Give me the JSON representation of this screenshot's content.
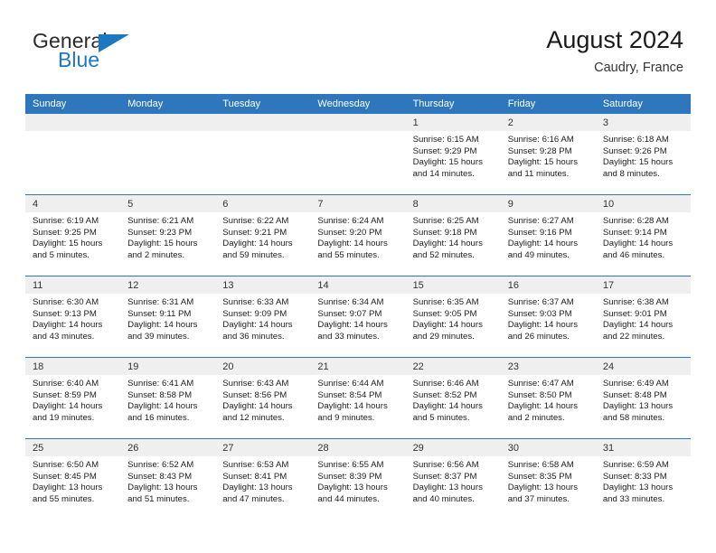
{
  "brand": {
    "name_part1": "General",
    "name_part2": "Blue",
    "accent_color": "#1c78c0"
  },
  "header": {
    "title": "August 2024",
    "subtitle": "Caudry, France"
  },
  "calendar": {
    "header_color": "#2e77bc",
    "daynum_band_color": "#efefef",
    "weekday_labels": [
      "Sunday",
      "Monday",
      "Tuesday",
      "Wednesday",
      "Thursday",
      "Friday",
      "Saturday"
    ],
    "labels": {
      "sunrise": "Sunrise:",
      "sunset": "Sunset:",
      "daylight": "Daylight:"
    },
    "weeks": [
      [
        {
          "day": "",
          "empty": true
        },
        {
          "day": "",
          "empty": true
        },
        {
          "day": "",
          "empty": true
        },
        {
          "day": "",
          "empty": true
        },
        {
          "day": "1",
          "sunrise": "Sunrise: 6:15 AM",
          "sunset": "Sunset: 9:29 PM",
          "daylight_line1": "Daylight: 15 hours",
          "daylight_line2": "and 14 minutes."
        },
        {
          "day": "2",
          "sunrise": "Sunrise: 6:16 AM",
          "sunset": "Sunset: 9:28 PM",
          "daylight_line1": "Daylight: 15 hours",
          "daylight_line2": "and 11 minutes."
        },
        {
          "day": "3",
          "sunrise": "Sunrise: 6:18 AM",
          "sunset": "Sunset: 9:26 PM",
          "daylight_line1": "Daylight: 15 hours",
          "daylight_line2": "and 8 minutes."
        }
      ],
      [
        {
          "day": "4",
          "sunrise": "Sunrise: 6:19 AM",
          "sunset": "Sunset: 9:25 PM",
          "daylight_line1": "Daylight: 15 hours",
          "daylight_line2": "and 5 minutes."
        },
        {
          "day": "5",
          "sunrise": "Sunrise: 6:21 AM",
          "sunset": "Sunset: 9:23 PM",
          "daylight_line1": "Daylight: 15 hours",
          "daylight_line2": "and 2 minutes."
        },
        {
          "day": "6",
          "sunrise": "Sunrise: 6:22 AM",
          "sunset": "Sunset: 9:21 PM",
          "daylight_line1": "Daylight: 14 hours",
          "daylight_line2": "and 59 minutes."
        },
        {
          "day": "7",
          "sunrise": "Sunrise: 6:24 AM",
          "sunset": "Sunset: 9:20 PM",
          "daylight_line1": "Daylight: 14 hours",
          "daylight_line2": "and 55 minutes."
        },
        {
          "day": "8",
          "sunrise": "Sunrise: 6:25 AM",
          "sunset": "Sunset: 9:18 PM",
          "daylight_line1": "Daylight: 14 hours",
          "daylight_line2": "and 52 minutes."
        },
        {
          "day": "9",
          "sunrise": "Sunrise: 6:27 AM",
          "sunset": "Sunset: 9:16 PM",
          "daylight_line1": "Daylight: 14 hours",
          "daylight_line2": "and 49 minutes."
        },
        {
          "day": "10",
          "sunrise": "Sunrise: 6:28 AM",
          "sunset": "Sunset: 9:14 PM",
          "daylight_line1": "Daylight: 14 hours",
          "daylight_line2": "and 46 minutes."
        }
      ],
      [
        {
          "day": "11",
          "sunrise": "Sunrise: 6:30 AM",
          "sunset": "Sunset: 9:13 PM",
          "daylight_line1": "Daylight: 14 hours",
          "daylight_line2": "and 43 minutes."
        },
        {
          "day": "12",
          "sunrise": "Sunrise: 6:31 AM",
          "sunset": "Sunset: 9:11 PM",
          "daylight_line1": "Daylight: 14 hours",
          "daylight_line2": "and 39 minutes."
        },
        {
          "day": "13",
          "sunrise": "Sunrise: 6:33 AM",
          "sunset": "Sunset: 9:09 PM",
          "daylight_line1": "Daylight: 14 hours",
          "daylight_line2": "and 36 minutes."
        },
        {
          "day": "14",
          "sunrise": "Sunrise: 6:34 AM",
          "sunset": "Sunset: 9:07 PM",
          "daylight_line1": "Daylight: 14 hours",
          "daylight_line2": "and 33 minutes."
        },
        {
          "day": "15",
          "sunrise": "Sunrise: 6:35 AM",
          "sunset": "Sunset: 9:05 PM",
          "daylight_line1": "Daylight: 14 hours",
          "daylight_line2": "and 29 minutes."
        },
        {
          "day": "16",
          "sunrise": "Sunrise: 6:37 AM",
          "sunset": "Sunset: 9:03 PM",
          "daylight_line1": "Daylight: 14 hours",
          "daylight_line2": "and 26 minutes."
        },
        {
          "day": "17",
          "sunrise": "Sunrise: 6:38 AM",
          "sunset": "Sunset: 9:01 PM",
          "daylight_line1": "Daylight: 14 hours",
          "daylight_line2": "and 22 minutes."
        }
      ],
      [
        {
          "day": "18",
          "sunrise": "Sunrise: 6:40 AM",
          "sunset": "Sunset: 8:59 PM",
          "daylight_line1": "Daylight: 14 hours",
          "daylight_line2": "and 19 minutes."
        },
        {
          "day": "19",
          "sunrise": "Sunrise: 6:41 AM",
          "sunset": "Sunset: 8:58 PM",
          "daylight_line1": "Daylight: 14 hours",
          "daylight_line2": "and 16 minutes."
        },
        {
          "day": "20",
          "sunrise": "Sunrise: 6:43 AM",
          "sunset": "Sunset: 8:56 PM",
          "daylight_line1": "Daylight: 14 hours",
          "daylight_line2": "and 12 minutes."
        },
        {
          "day": "21",
          "sunrise": "Sunrise: 6:44 AM",
          "sunset": "Sunset: 8:54 PM",
          "daylight_line1": "Daylight: 14 hours",
          "daylight_line2": "and 9 minutes."
        },
        {
          "day": "22",
          "sunrise": "Sunrise: 6:46 AM",
          "sunset": "Sunset: 8:52 PM",
          "daylight_line1": "Daylight: 14 hours",
          "daylight_line2": "and 5 minutes."
        },
        {
          "day": "23",
          "sunrise": "Sunrise: 6:47 AM",
          "sunset": "Sunset: 8:50 PM",
          "daylight_line1": "Daylight: 14 hours",
          "daylight_line2": "and 2 minutes."
        },
        {
          "day": "24",
          "sunrise": "Sunrise: 6:49 AM",
          "sunset": "Sunset: 8:48 PM",
          "daylight_line1": "Daylight: 13 hours",
          "daylight_line2": "and 58 minutes."
        }
      ],
      [
        {
          "day": "25",
          "sunrise": "Sunrise: 6:50 AM",
          "sunset": "Sunset: 8:45 PM",
          "daylight_line1": "Daylight: 13 hours",
          "daylight_line2": "and 55 minutes."
        },
        {
          "day": "26",
          "sunrise": "Sunrise: 6:52 AM",
          "sunset": "Sunset: 8:43 PM",
          "daylight_line1": "Daylight: 13 hours",
          "daylight_line2": "and 51 minutes."
        },
        {
          "day": "27",
          "sunrise": "Sunrise: 6:53 AM",
          "sunset": "Sunset: 8:41 PM",
          "daylight_line1": "Daylight: 13 hours",
          "daylight_line2": "and 47 minutes."
        },
        {
          "day": "28",
          "sunrise": "Sunrise: 6:55 AM",
          "sunset": "Sunset: 8:39 PM",
          "daylight_line1": "Daylight: 13 hours",
          "daylight_line2": "and 44 minutes."
        },
        {
          "day": "29",
          "sunrise": "Sunrise: 6:56 AM",
          "sunset": "Sunset: 8:37 PM",
          "daylight_line1": "Daylight: 13 hours",
          "daylight_line2": "and 40 minutes."
        },
        {
          "day": "30",
          "sunrise": "Sunrise: 6:58 AM",
          "sunset": "Sunset: 8:35 PM",
          "daylight_line1": "Daylight: 13 hours",
          "daylight_line2": "and 37 minutes."
        },
        {
          "day": "31",
          "sunrise": "Sunrise: 6:59 AM",
          "sunset": "Sunset: 8:33 PM",
          "daylight_line1": "Daylight: 13 hours",
          "daylight_line2": "and 33 minutes."
        }
      ]
    ]
  }
}
